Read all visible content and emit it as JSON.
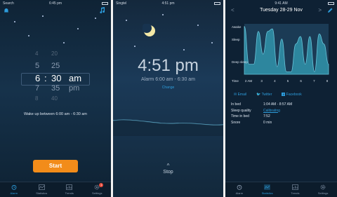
{
  "screen1": {
    "status": {
      "carrier": "Search",
      "time": "6:45 pm"
    },
    "picker": {
      "rows": [
        {
          "h": "4",
          "m": "20",
          "ap": ""
        },
        {
          "h": "5",
          "m": "25",
          "ap": ""
        },
        {
          "h": "6",
          "m": "30",
          "ap": "am"
        },
        {
          "h": "7",
          "m": "35",
          "ap": "pm"
        },
        {
          "h": "8",
          "m": "40",
          "ap": ""
        }
      ],
      "colon": ":"
    },
    "wake_text": "Wake up between 6:00 am - 6:30 am",
    "start_label": "Start"
  },
  "screen2": {
    "status": {
      "carrier": "Singtel",
      "time": "4:51 pm"
    },
    "time": "4:51 pm",
    "alarm": "Alarm 6:00 am - 6:30 am",
    "change": "Change",
    "stop_chevron": "^",
    "stop": "Stop"
  },
  "screen3": {
    "status": {
      "time": "9:41 AM"
    },
    "date": "Tuesday 28-29 Nov",
    "prev": "<",
    "next": ">",
    "chart_data": {
      "type": "area",
      "ylabels": [
        "Awake",
        "Sleep",
        "Deep sleep"
      ],
      "xlabel": "Time",
      "x": [
        "2 AM",
        "3",
        "4",
        "5",
        "6",
        "7",
        "8"
      ],
      "values": [
        0.95,
        0.2,
        0.2,
        0.85,
        0.4,
        0.85,
        0.9,
        0.15,
        0.7,
        0.05,
        0.05,
        0.6,
        0.75,
        0.2,
        0.75,
        0.05,
        0.8,
        0.6,
        0.2
      ]
    },
    "share": {
      "email": "Email",
      "twitter": "Twitter",
      "facebook": "Facebook"
    },
    "stats": [
      {
        "k": "In bed",
        "v": "1:04 AM - 8:57 AM"
      },
      {
        "k": "Sleep quality",
        "v": "Calibrating"
      },
      {
        "k": "Time in bed",
        "v": "7:52"
      },
      {
        "k": "Snore",
        "v": "0 min"
      }
    ]
  },
  "tabs": {
    "alarm": "Alarm",
    "statistics": "Statistics",
    "trends": "Trends",
    "settings": "Settings",
    "badge": "1"
  },
  "colors": {
    "accent": "#2d9cdb",
    "start": "#f28c1a",
    "chart_fill": "#2f8fa6"
  }
}
